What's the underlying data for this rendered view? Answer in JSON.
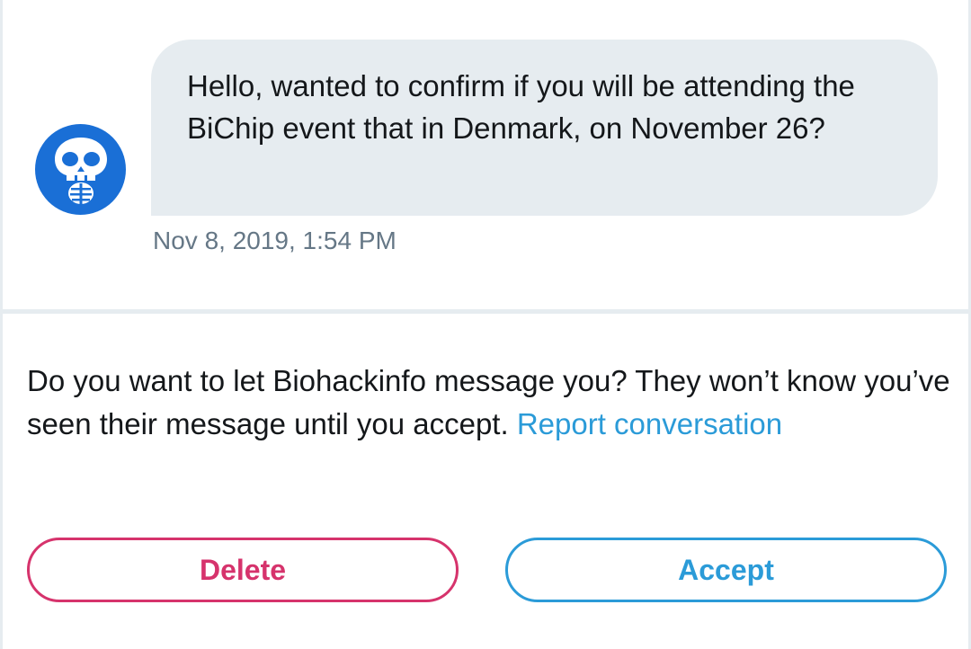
{
  "conversation": {
    "sender_avatar_icon": "skull-skeleton-icon",
    "avatar_color": "#1a6fd6",
    "message": {
      "text": "Hello, wanted to confirm if you will be attending the BiChip event that in Denmark, on November 26?",
      "timestamp": "Nov 8, 2019, 1:54 PM"
    }
  },
  "request": {
    "prompt_text": "Do you want to let Biohackinfo message you? They won’t know you’ve seen their message until you accept. ",
    "report_link": "Report conversation",
    "delete_label": "Delete",
    "accept_label": "Accept",
    "delete_color": "#d6336c",
    "accept_color": "#2b9bd8"
  }
}
